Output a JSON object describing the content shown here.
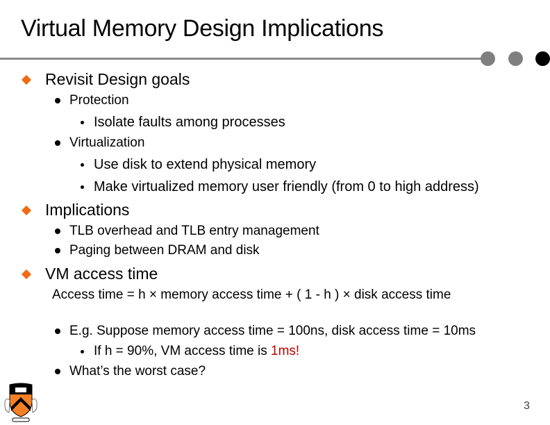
{
  "slide": {
    "title": "Virtual Memory Design Implications",
    "page_number": "3",
    "colors": {
      "accent_bullet": "#f26a12",
      "highlight": "#c00000",
      "rule": "#8c8c8c"
    },
    "logo_icon": "princeton-shield-icon"
  },
  "content": {
    "s1": {
      "label": "Revisit Design goals",
      "protection": "Protection",
      "protection_sub": "Isolate faults among processes",
      "virtualization": "Virtualization",
      "virt_sub1": "Use disk  to extend physical memory",
      "virt_sub2": "Make virtualized memory user friendly (from 0 to high address)"
    },
    "s2": {
      "label": "Implications",
      "item1": "TLB overhead and TLB entry management",
      "item2": "Paging between DRAM and disk"
    },
    "s3": {
      "label": "VM access time",
      "formula": "Access time = h × memory access time + ( 1 - h ) × disk access time",
      "example": "E.g. Suppose memory access time = 100ns, disk access time = 10ms",
      "example_sub_prefix": "If h = 90%, VM access time is ",
      "example_sub_highlight": "1ms!",
      "question": "What’s the worst case?"
    }
  }
}
